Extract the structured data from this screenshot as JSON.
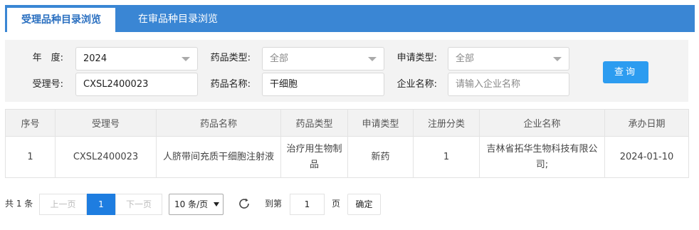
{
  "tabs": [
    {
      "label": "受理品种目录浏览",
      "active": true
    },
    {
      "label": "在审品种目录浏览",
      "active": false
    }
  ],
  "filters": {
    "year": {
      "label": "年　度:",
      "value": "2024"
    },
    "drug_type": {
      "label": "药品类型:",
      "value": "全部"
    },
    "apply_type": {
      "label": "申请类型:",
      "value": "全部"
    },
    "accept_no": {
      "label": "受理号:",
      "value": "CXSL2400023"
    },
    "drug_name": {
      "label": "药品名称:",
      "value": "干细胞"
    },
    "company": {
      "label": "企业名称:",
      "placeholder": "请输入企业名称"
    },
    "query_label": "查询"
  },
  "table": {
    "headers": [
      "序号",
      "受理号",
      "药品名称",
      "药品类型",
      "申请类型",
      "注册分类",
      "企业名称",
      "承办日期"
    ],
    "rows": [
      [
        "1",
        "CXSL2400023",
        "人脐带间充质干细胞注射液",
        "治疗用生物制品",
        "新药",
        "1",
        "吉林省拓华生物科技有限公司;",
        "2024-01-10"
      ]
    ]
  },
  "pagination": {
    "total": "共 1 条",
    "prev": "上一页",
    "current": "1",
    "next": "下一页",
    "page_size": "10 条/页",
    "goto_prefix": "到第",
    "goto_value": "1",
    "goto_suffix": "页",
    "confirm": "确定"
  },
  "colors": {
    "tab_bar": "#3a86d4",
    "primary_button": "#2c9cf0",
    "current_page": "#1e7de0"
  }
}
